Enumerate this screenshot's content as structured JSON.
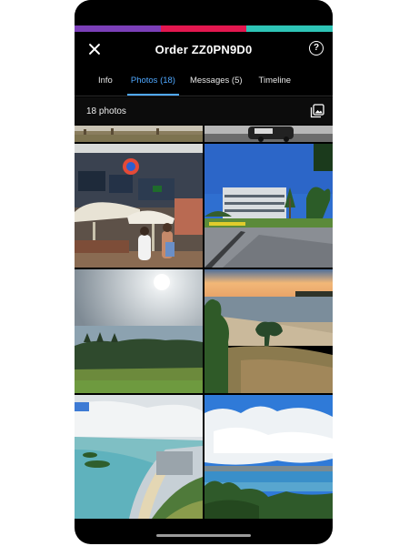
{
  "header": {
    "title": "Order ZZ0PN9D0",
    "close_icon": "close-icon",
    "help_icon": "help-icon",
    "help_glyph": "?"
  },
  "brand_colors": [
    "#7b3fb8",
    "#e3174f",
    "#2ec4b6"
  ],
  "tabs": [
    {
      "label": "Info",
      "active": false
    },
    {
      "label": "Photos (18)",
      "active": true
    },
    {
      "label": "Messages (5)",
      "active": false
    },
    {
      "label": "Timeline",
      "active": false
    }
  ],
  "photos_count_label": "18 photos",
  "gallery_icon": "gallery-icon",
  "accent": "#4fa8ff"
}
